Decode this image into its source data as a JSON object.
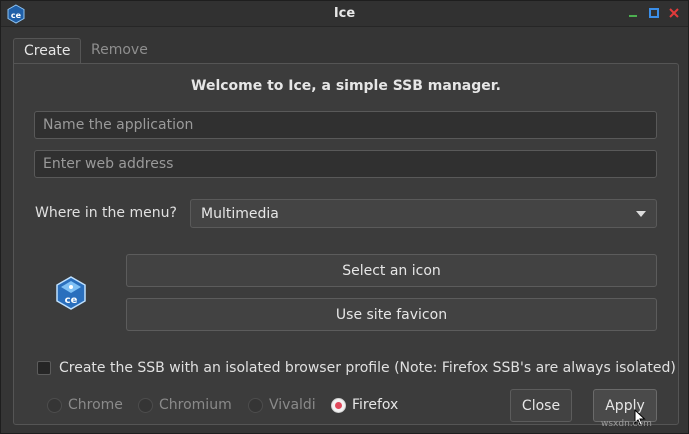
{
  "window": {
    "title": "Ice",
    "controls": [
      "minimize-icon",
      "maximize-icon",
      "close-icon"
    ]
  },
  "tabs": [
    {
      "label": "Create",
      "active": true
    },
    {
      "label": "Remove",
      "active": false
    }
  ],
  "welcome": "Welcome to Ice, a simple SSB manager.",
  "form": {
    "name_placeholder": "Name the application",
    "name_value": "",
    "url_placeholder": "Enter web address",
    "url_value": "",
    "menu_label": "Where in the menu?",
    "menu_selected": "Multimedia"
  },
  "buttons": {
    "select_icon": "Select an icon",
    "use_favicon": "Use site favicon",
    "close": "Close",
    "apply": "Apply"
  },
  "isolated_profile": {
    "label": "Create the SSB with an isolated browser profile (Note: Firefox SSB's are always isolated)",
    "checked": false
  },
  "browsers": [
    {
      "label": "Chrome",
      "selected": false
    },
    {
      "label": "Chromium",
      "selected": false
    },
    {
      "label": "Vivaldi",
      "selected": false
    },
    {
      "label": "Firefox",
      "selected": true
    }
  ],
  "watermark": "wsxdn.com",
  "colors": {
    "background": "#353535",
    "panel": "#3c3c3c",
    "radio_accent": "#e0485b",
    "maximize": "#3b8ee8",
    "close": "#e23b3b",
    "minimize": "#4caf50"
  }
}
